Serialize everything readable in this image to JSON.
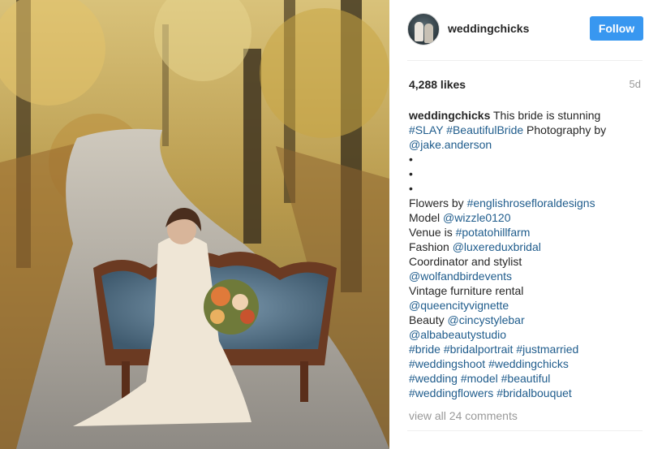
{
  "post": {
    "photo_description_icon": "photo",
    "author": "weddingchicks",
    "follow_label": "Follow",
    "likes": "4,288 likes",
    "age": "5d",
    "caption": {
      "username": "weddingchicks",
      "intro": "This bride is stunning",
      "line2_tag1": "#SLAY",
      "line2_tag2": "#BeautifulBride",
      "line2_text": "Photography by",
      "photographer": "@jake.anderson",
      "bullet": "•",
      "flowers_label": "Flowers by",
      "flowers_tag": "#englishrosefloraldesigns",
      "model_label": "Model",
      "model_tag": "@wizzle0120",
      "venue_label": "Venue is",
      "venue_tag": "#potatohillfarm",
      "fashion_label": "Fashion",
      "fashion_tag": "@luxereduxbridal",
      "coordinator_label": "Coordinator and stylist",
      "coordinator_tag": "@wolfandbirdevents",
      "furniture_label": "Vintage furniture rental",
      "furniture_tag": "@queencityvignette",
      "beauty_label": "Beauty",
      "beauty_tag1": "@cincystylebar",
      "beauty_tag2": "@albabeautystudio",
      "tags": [
        [
          "#bride",
          "#bridalportrait",
          "#justmarried"
        ],
        [
          "#weddingshoot",
          "#weddingchicks"
        ],
        [
          "#wedding",
          "#model",
          "#beautiful"
        ],
        [
          "#weddingflowers",
          "#bridalbouquet"
        ]
      ]
    },
    "view_all": "view all 24 comments"
  }
}
